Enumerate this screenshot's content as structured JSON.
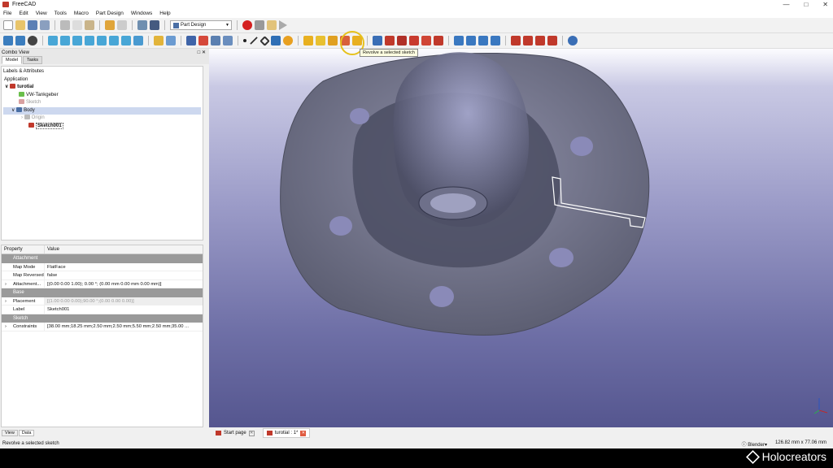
{
  "window": {
    "title": "FreeCAD"
  },
  "menu": [
    "File",
    "Edit",
    "View",
    "Tools",
    "Macro",
    "Part Design",
    "Windows",
    "Help"
  ],
  "toolbar": {
    "workbench": "Part Design",
    "tooltip": "Revolve a selected sketch"
  },
  "combo_view": {
    "title": "Combo View",
    "tabs": [
      "Model",
      "Tasks"
    ],
    "section": "Labels & Attributes",
    "root": "Application",
    "tree": [
      {
        "label": "turotial"
      },
      {
        "label": "VW-Tankgeber"
      },
      {
        "label": "Sketch"
      },
      {
        "label": "Body"
      },
      {
        "label": "Origin"
      },
      {
        "label": "Sketch001"
      }
    ]
  },
  "properties": {
    "header": {
      "property": "Property",
      "value": "Value"
    },
    "groups": {
      "attachment": "Attachment",
      "base": "Base",
      "sketch": "Sketch"
    },
    "rows": {
      "map_mode": {
        "k": "Map Mode",
        "v": "FlatFace"
      },
      "map_reversed": {
        "k": "Map Reversed",
        "v": "false"
      },
      "attachment": {
        "k": "Attachment...",
        "v": "[(0.00 0.00 1.00); 0.00 °; (0.00 mm  0.00 mm  0.00 mm)]"
      },
      "placement": {
        "k": "Placement",
        "v": "[(1.00 0.00 0.00);90.00 °;(0.00 0.00 0.00)]"
      },
      "label": {
        "k": "Label",
        "v": "Sketch001"
      },
      "constraints": {
        "k": "Constraints",
        "v": "[38.00 mm;18.25 mm;2.50 mm;2.50 mm;5.50 mm;2.50 mm;35.00 ..."
      }
    }
  },
  "bottom_tabs": [
    "View",
    "Data"
  ],
  "doc_tabs": [
    {
      "label": "Start page"
    },
    {
      "label": "turotial : 1*"
    }
  ],
  "status": {
    "left": "Revolve a selected sketch",
    "nav": "Blender",
    "dims": "126.82 mm x 77.06 mm"
  },
  "brand": "Holocreators",
  "colors": {
    "viewport_top": "#fcfcff",
    "viewport_bottom": "#55568f",
    "group_row": "#9a9a9a"
  }
}
